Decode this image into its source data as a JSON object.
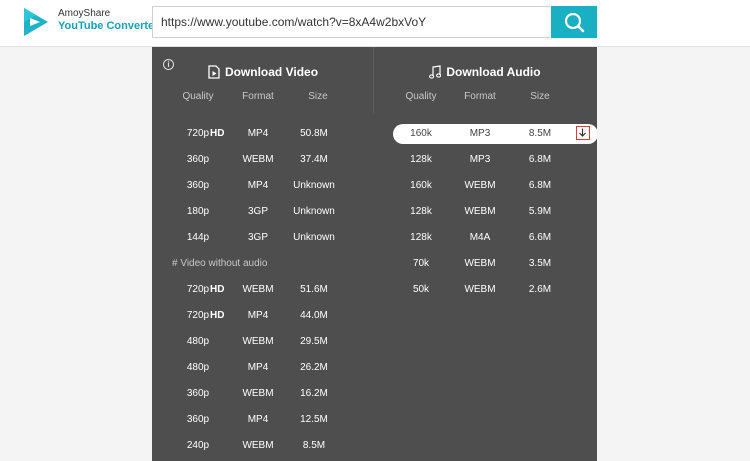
{
  "header": {
    "brand_top": "AmoyShare",
    "brand_bottom": "YouTube Converter",
    "url_value": "https://www.youtube.com/watch?v=8xA4w2bxVoY",
    "search_icon": "search-icon",
    "accent_color": "#19b0c4"
  },
  "panel": {
    "info_glyph": "i",
    "video": {
      "title": "Download Video",
      "icon": "video-file-icon",
      "headers": {
        "quality": "Quality",
        "format": "Format",
        "size": "Size"
      },
      "rows": [
        {
          "quality": "720p",
          "hd": "HD",
          "format": "MP4",
          "size": "50.8M"
        },
        {
          "quality": "360p",
          "format": "WEBM",
          "size": "37.4M"
        },
        {
          "quality": "360p",
          "format": "MP4",
          "size": "Unknown"
        },
        {
          "quality": "180p",
          "format": "3GP",
          "size": "Unknown"
        },
        {
          "quality": "144p",
          "format": "3GP",
          "size": "Unknown"
        }
      ],
      "without_audio_label": "# Video without audio",
      "no_audio_rows": [
        {
          "quality": "720p",
          "hd": "HD",
          "format": "WEBM",
          "size": "51.6M"
        },
        {
          "quality": "720p",
          "hd": "HD",
          "format": "MP4",
          "size": "44.0M"
        },
        {
          "quality": "480p",
          "format": "WEBM",
          "size": "29.5M"
        },
        {
          "quality": "480p",
          "format": "MP4",
          "size": "26.2M"
        },
        {
          "quality": "360p",
          "format": "WEBM",
          "size": "16.2M"
        },
        {
          "quality": "360p",
          "format": "MP4",
          "size": "12.5M"
        },
        {
          "quality": "240p",
          "format": "WEBM",
          "size": "8.5M"
        }
      ]
    },
    "audio": {
      "title": "Download Audio",
      "icon": "music-note-icon",
      "headers": {
        "quality": "Quality",
        "format": "Format",
        "size": "Size"
      },
      "rows": [
        {
          "quality": "160k",
          "format": "MP3",
          "size": "8.5M",
          "selected": true
        },
        {
          "quality": "128k",
          "format": "MP3",
          "size": "6.8M"
        },
        {
          "quality": "160k",
          "format": "WEBM",
          "size": "6.8M"
        },
        {
          "quality": "128k",
          "format": "WEBM",
          "size": "5.9M"
        },
        {
          "quality": "128k",
          "format": "M4A",
          "size": "6.6M"
        },
        {
          "quality": "70k",
          "format": "WEBM",
          "size": "3.5M"
        },
        {
          "quality": "50k",
          "format": "WEBM",
          "size": "2.6M"
        }
      ],
      "download_icon": "download-arrow-icon"
    }
  }
}
